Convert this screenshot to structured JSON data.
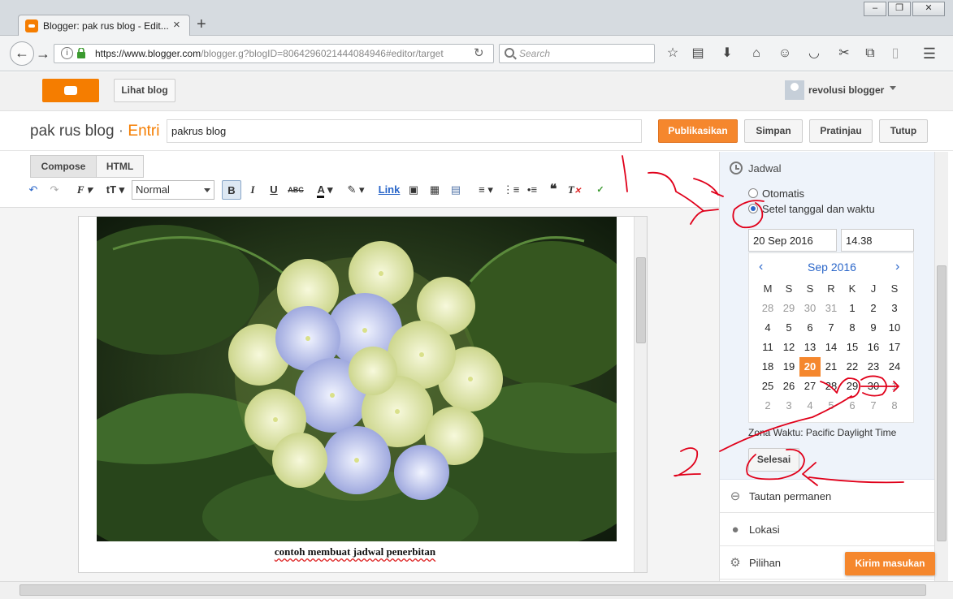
{
  "browser": {
    "tab_title": "Blogger: pak rus blog - Edit...",
    "tab_close": "×",
    "new_tab": "+",
    "url_host": "https://www.blogger.com",
    "url_path": "/blogger.g?blogID=8064296021444084946#editor/target",
    "search_placeholder": "Search",
    "window_buttons": [
      "–",
      "❐",
      "✕"
    ]
  },
  "header": {
    "view_blog_label": "Lihat blog",
    "user_name": "revolusi blogger"
  },
  "post": {
    "blog_name": "pak rus blog",
    "separator": " · ",
    "section": "Entri",
    "title_value": "pakrus blog",
    "buttons": {
      "publish": "Publikasikan",
      "save": "Simpan",
      "preview": "Pratinjau",
      "close": "Tutup"
    }
  },
  "editor": {
    "tabs": {
      "compose": "Compose",
      "html": "HTML"
    },
    "format_value": "Normal",
    "link_label": "Link",
    "caption": "contoh membuat jadwal penerbitan"
  },
  "schedule": {
    "title": "Jadwal",
    "option_auto": "Otomatis",
    "option_manual": "Setel tanggal dan waktu",
    "date_value": "20 Sep 2016",
    "time_value": "14.38",
    "month_label": "Sep 2016",
    "prev": "‹",
    "next": "›",
    "weekdays": [
      "M",
      "S",
      "S",
      "R",
      "K",
      "J",
      "S"
    ],
    "weeks": [
      [
        "28",
        "29",
        "30",
        "31",
        "1",
        "2",
        "3"
      ],
      [
        "4",
        "5",
        "6",
        "7",
        "8",
        "9",
        "10"
      ],
      [
        "11",
        "12",
        "13",
        "14",
        "15",
        "16",
        "17"
      ],
      [
        "18",
        "19",
        "20",
        "21",
        "22",
        "23",
        "24"
      ],
      [
        "25",
        "26",
        "27",
        "28",
        "29",
        "30",
        "1"
      ],
      [
        "2",
        "3",
        "4",
        "5",
        "6",
        "7",
        "8"
      ]
    ],
    "selected_day": "20",
    "timezone": "Zona Waktu: Pacific Daylight Time",
    "done_label": "Selesai"
  },
  "sidebar": {
    "items": [
      {
        "label": "Tautan permanen",
        "icon": "link-icon"
      },
      {
        "label": "Lokasi",
        "icon": "location-pin-icon"
      },
      {
        "label": "Pilihan",
        "icon": "gear-icon"
      }
    ],
    "feedback_label": "Kirim masukan"
  },
  "colors": {
    "accent_orange": "#f5872d",
    "link_blue": "#2a66c9",
    "annotation_red": "#e0001a"
  }
}
